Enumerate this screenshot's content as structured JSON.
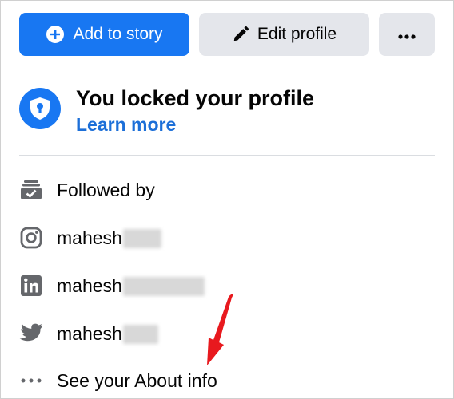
{
  "actions": {
    "add_story_label": "Add to story",
    "edit_profile_label": "Edit profile",
    "more_icon": "more-horizontal-icon",
    "colors": {
      "primary": "#1877f2",
      "secondary": "#e4e6eb"
    }
  },
  "lock_notice": {
    "title": "You locked your profile",
    "link": "Learn more",
    "icon": "shield-keyhole-icon"
  },
  "info_items": [
    {
      "icon": "followers-icon",
      "text": "Followed by"
    },
    {
      "icon": "instagram-icon",
      "text": "mahesh"
    },
    {
      "icon": "linkedin-icon",
      "text": "mahesh"
    },
    {
      "icon": "twitter-icon",
      "text": "mahesh"
    },
    {
      "icon": "more-horizontal-icon",
      "text": "See your About info"
    }
  ],
  "annotation": {
    "color": "#e8191e"
  }
}
